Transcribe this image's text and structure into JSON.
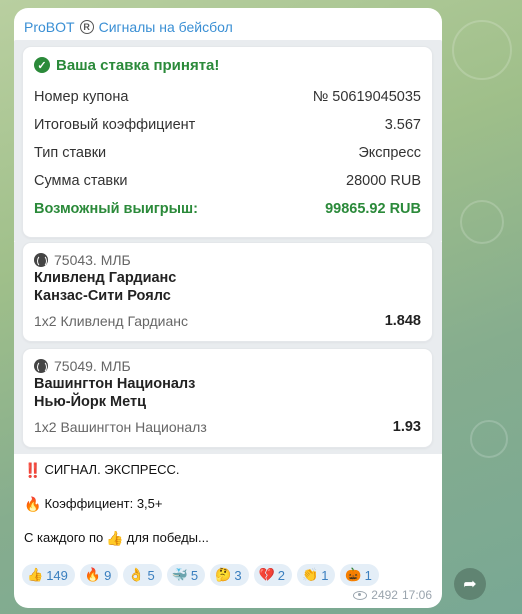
{
  "channel": {
    "title": "ProBOT",
    "subtitle": "Сигналы на бейсбол"
  },
  "summary": {
    "accepted": "Ваша ставка принята!",
    "rows": [
      {
        "label": "Номер купона",
        "value": "№ 50619045035"
      },
      {
        "label": "Итоговый коэффициент",
        "value": "3.567"
      },
      {
        "label": "Тип ставки",
        "value": "Экспресс"
      },
      {
        "label": "Сумма ставки",
        "value": "28000 RUB"
      }
    ],
    "win_label": "Возможный выигрыш:",
    "win_value": "99865.92 RUB"
  },
  "bets": [
    {
      "league": "75043. МЛБ",
      "team1": "Кливленд Гардианс",
      "team2": "Канзас-Сити Роялс",
      "pick": "1х2 Кливленд Гардианс",
      "odds": "1.848"
    },
    {
      "league": "75049. МЛБ",
      "team1": "Вашингтон Националз",
      "team2": "Нью-Йорк Метц",
      "pick": "1х2 Вашингтон Националз",
      "odds": "1.93"
    }
  ],
  "message": {
    "line1_emoji": "‼️",
    "line1": "СИГНАЛ. ЭКСПРЕСС.",
    "line2_emoji": "🔥",
    "line2": "Коэффициент: 3,5+",
    "line3a": "С каждого по",
    "line3_emoji": "👍",
    "line3b": "для победы..."
  },
  "reactions": [
    {
      "emoji": "👍",
      "count": "149"
    },
    {
      "emoji": "🔥",
      "count": "9"
    },
    {
      "emoji": "👌",
      "count": "5"
    },
    {
      "emoji": "🐳",
      "count": "5"
    },
    {
      "emoji": "🤔",
      "count": "3"
    },
    {
      "emoji": "💔",
      "count": "2"
    },
    {
      "emoji": "👏",
      "count": "1"
    },
    {
      "emoji": "🎃",
      "count": "1"
    }
  ],
  "meta": {
    "views": "2492",
    "time": "17:06"
  }
}
